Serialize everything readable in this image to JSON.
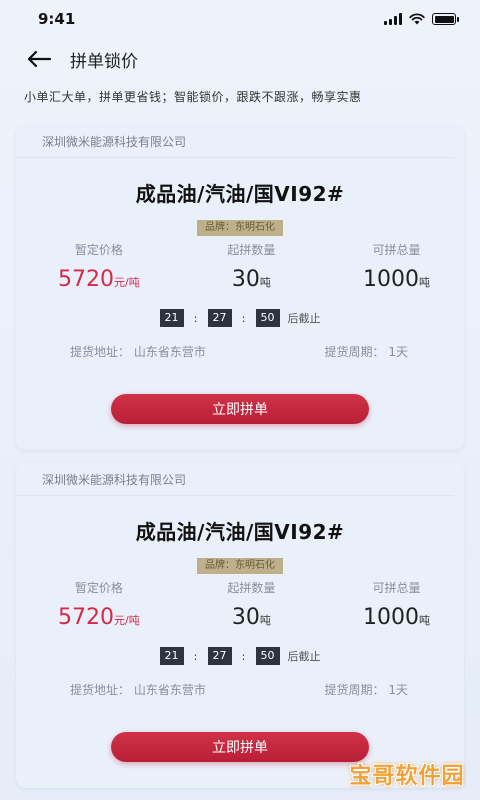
{
  "status_bar": {
    "time": "9:41"
  },
  "nav": {
    "title": "拼单锁价"
  },
  "slogan": "小单汇大单，拼单更省钱；智能锁价，跟跌不跟涨，畅享实惠",
  "cards": [
    {
      "company": "深圳微米能源科技有限公司",
      "product": "成品油/汽油/国VI92#",
      "brand": "品牌：东明石化",
      "price_label": "暂定价格",
      "price_value": "5720",
      "price_unit": "元/吨",
      "min_label": "起拼数量",
      "min_value": "30",
      "min_unit": "吨",
      "total_label": "可拼总量",
      "total_value": "1000",
      "total_unit": "吨",
      "countdown": {
        "h": "21",
        "m": "27",
        "s": "50",
        "suffix": "后截止"
      },
      "address": "提货地址：  山东省东营市",
      "period": "提货周期：  1天",
      "button": "立即拼单"
    },
    {
      "company": "深圳微米能源科技有限公司",
      "product": "成品油/汽油/国VI92#",
      "brand": "品牌：东明石化",
      "price_label": "暂定价格",
      "price_value": "5720",
      "price_unit": "元/吨",
      "min_label": "起拼数量",
      "min_value": "30",
      "min_unit": "吨",
      "total_label": "可拼总量",
      "total_value": "1000",
      "total_unit": "吨",
      "countdown": {
        "h": "21",
        "m": "27",
        "s": "50",
        "suffix": "后截止"
      },
      "address": "提货地址：  山东省东营市",
      "period": "提货周期：  1天",
      "button": "立即拼单"
    }
  ],
  "watermark": "宝哥软件园",
  "colors": {
    "accent": "#d6294a",
    "button": "#c3283f",
    "brand_tag": "#bdb08b",
    "countdown_bg": "#2f3340"
  }
}
